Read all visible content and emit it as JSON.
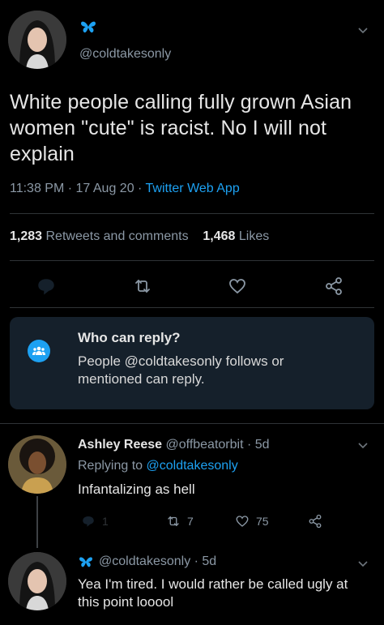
{
  "main_tweet": {
    "handle": "@coldtakesonly",
    "text": "White people calling fully grown Asian women \"cute\" is racist. No I will not explain",
    "time": "11:38 PM · 17 Aug 20 · ",
    "app": "Twitter Web App",
    "retweets_count": "1,283",
    "retweets_label": "Retweets and comments",
    "likes_count": "1,468",
    "likes_label": "Likes"
  },
  "who_can_reply": {
    "title": "Who can reply?",
    "body": "People @coldtakesonly follows or mentioned can reply."
  },
  "replies": [
    {
      "name": "Ashley Reese",
      "handle": "@offbeatorbit · 5d",
      "replying_prefix": "Replying to ",
      "replying_to": "@coldtakesonly",
      "text": "Infantalizing as hell",
      "reply_count": "1",
      "retweet_count": "7",
      "like_count": "75"
    },
    {
      "handle": "@coldtakesonly · 5d",
      "text": "Yea I'm tired. I would rather be called ugly at this point looool"
    }
  ],
  "colors": {
    "background": "#000000",
    "accent": "#1da1f2",
    "muted": "#8b98a5",
    "box": "#15202b"
  },
  "icons": [
    "butterfly-icon",
    "chevron-down-icon",
    "reply-icon",
    "retweet-icon",
    "like-icon",
    "share-icon",
    "people-icon"
  ]
}
